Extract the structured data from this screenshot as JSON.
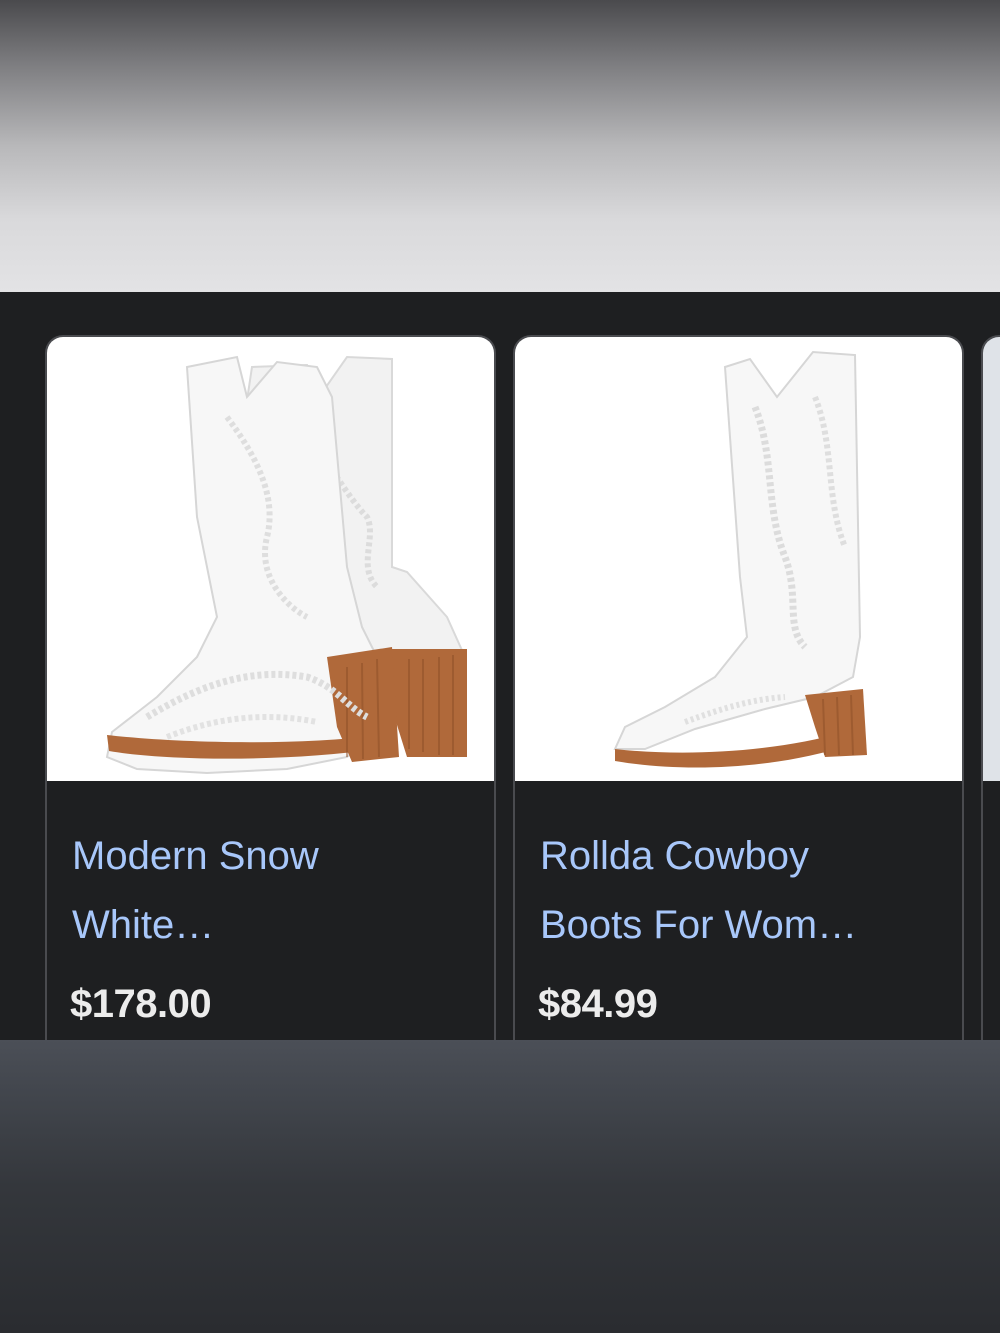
{
  "products": [
    {
      "title_line1": "Modern Snow",
      "title_line2": "White…",
      "price": "$178.00",
      "image_icon": "white-ankle-cowboy-boots-pair"
    },
    {
      "title_line1": "Rollda Cowboy",
      "title_line2": "Boots For Wom…",
      "price": "$84.99",
      "image_icon": "white-tall-cowboy-boot"
    }
  ],
  "colors": {
    "card_background": "#1e1f21",
    "title_link": "#a8c7fa",
    "price_text": "#ececec",
    "card_border": "#4a4b4f",
    "heel": "#b0693a"
  }
}
